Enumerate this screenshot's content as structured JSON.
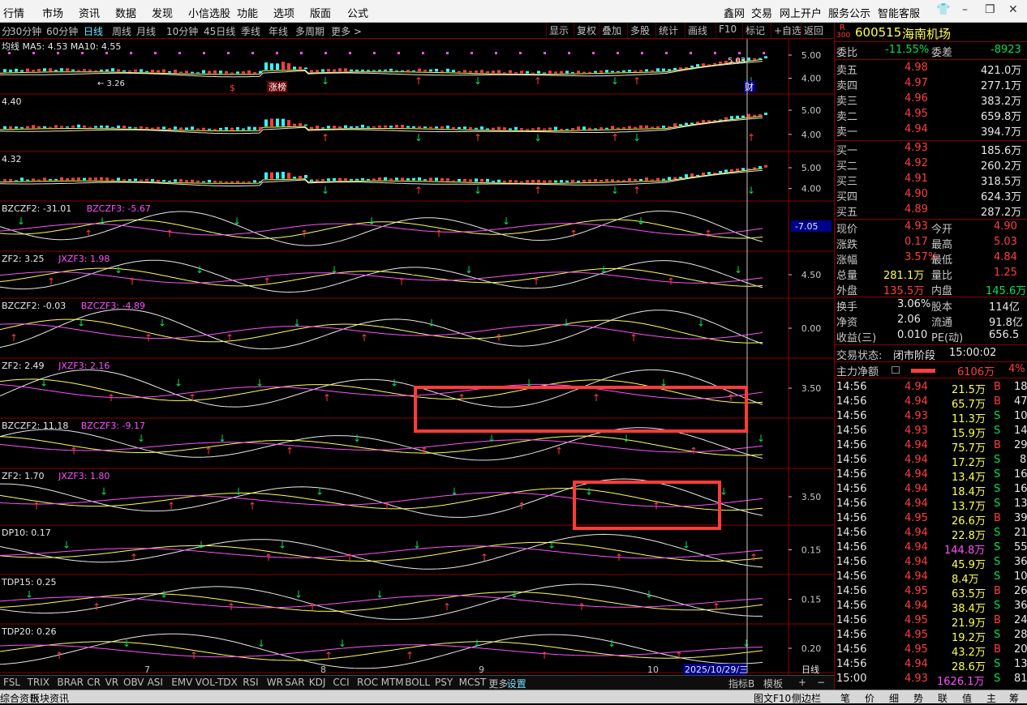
{
  "menu": {
    "items": [
      "行情",
      "市场",
      "资讯",
      "数据",
      "发现",
      "小信选股",
      "功能",
      "选项",
      "版面",
      "公式"
    ],
    "right_items": [
      "鑫网",
      "交易",
      "网上开户",
      "服务公示",
      "智能客服"
    ],
    "window_icons": [
      "shirt-icon",
      "minimize-icon",
      "restore-icon",
      "close-icon"
    ]
  },
  "periods": {
    "items": [
      "分",
      "30分钟",
      "60分钟",
      "日线",
      "周线",
      "月线",
      "10分钟",
      "45日线",
      "季线",
      "年线",
      "多周期",
      "更多 >"
    ],
    "active": "日线",
    "tools": [
      "显示",
      "复权",
      "叠加",
      "多股",
      "统计",
      "画线",
      "F10",
      "标记",
      "+自选",
      "返回"
    ]
  },
  "panes": [
    {
      "label_a": "均线  MA5: 4.53  MA10: 4.55",
      "label_b": "",
      "axis": [
        "5.00",
        "4.00"
      ],
      "notes": [
        "3.26",
        "5.03",
        "涨榜",
        "财",
        "$"
      ]
    },
    {
      "label_a": "4.40",
      "label_b": "",
      "axis": [
        "5.00",
        "4.00"
      ]
    },
    {
      "label_a": "4.32",
      "label_b": "",
      "axis": [
        "5.00",
        "4.00"
      ]
    },
    {
      "label_a": "BZCZF2: -31.01",
      "label_b": "BZCZF3: -5.67",
      "axis": [
        "-7.05"
      ]
    },
    {
      "label_a": "ZF2: 3.25",
      "label_b": "JXZF3: 1.98",
      "axis": [
        "4.50"
      ]
    },
    {
      "label_a": "BZCZF2: -0.03",
      "label_b": "BZCZF3: -4.89",
      "axis": [
        "0.00"
      ]
    },
    {
      "label_a": "ZF2: 2.49",
      "label_b": "JXZF3: 2.16",
      "axis": [
        "3.50"
      ]
    },
    {
      "label_a": "BZCZF2: 11.18",
      "label_b": "BZCZF3: -9.17",
      "axis": []
    },
    {
      "label_a": "ZF2: 1.70",
      "label_b": "JXZF3: 1.80",
      "axis": [
        "3.50"
      ]
    },
    {
      "label_a": "DP10: 0.17",
      "label_b": "",
      "axis": [
        "0.15"
      ]
    },
    {
      "label_a": "TDP15: 0.25",
      "label_b": "",
      "axis": [
        "0.15"
      ]
    },
    {
      "label_a": "TDP20: 0.26",
      "label_b": "",
      "axis": [
        "0.20"
      ]
    }
  ],
  "x_axis": {
    "months": [
      "7",
      "8",
      "9",
      "10"
    ],
    "date_label": "2025/10/29/三",
    "period_label": "日线"
  },
  "stock": {
    "code": "600515",
    "name": "海南机场",
    "prefix_top": "R",
    "prefix_bottom": "300"
  },
  "committee": {
    "ratio_label": "委比",
    "ratio": "-11.55%",
    "diff_label": "委差",
    "diff": "-8923"
  },
  "asks": [
    {
      "label": "卖五",
      "price": "4.98",
      "vol": "421.0万"
    },
    {
      "label": "卖四",
      "price": "4.97",
      "vol": "277.1万"
    },
    {
      "label": "卖三",
      "price": "4.96",
      "vol": "383.2万"
    },
    {
      "label": "卖二",
      "price": "4.95",
      "vol": "659.8万"
    },
    {
      "label": "卖一",
      "price": "4.94",
      "vol": "394.7万"
    }
  ],
  "bids": [
    {
      "label": "买一",
      "price": "4.93",
      "vol": "185.6万"
    },
    {
      "label": "买二",
      "price": "4.92",
      "vol": "260.2万"
    },
    {
      "label": "买三",
      "price": "4.91",
      "vol": "318.5万"
    },
    {
      "label": "买四",
      "price": "4.90",
      "vol": "624.3万"
    },
    {
      "label": "买五",
      "price": "4.89",
      "vol": "287.2万"
    }
  ],
  "quote": [
    {
      "l1": "现价",
      "v1": "4.93",
      "c1": "red",
      "l2": "今开",
      "v2": "4.90",
      "c2": "red"
    },
    {
      "l1": "涨跌",
      "v1": "0.17",
      "c1": "red",
      "l2": "最高",
      "v2": "5.03",
      "c2": "red"
    },
    {
      "l1": "涨幅",
      "v1": "3.57%",
      "c1": "red",
      "l2": "最低",
      "v2": "4.84",
      "c2": "red"
    },
    {
      "l1": "总量",
      "v1": "281.1万",
      "c1": "yel",
      "l2": "量比",
      "v2": "1.25",
      "c2": "red"
    },
    {
      "l1": "外盘",
      "v1": "135.5万",
      "c1": "red",
      "l2": "内盘",
      "v2": "145.6万",
      "c2": "grn"
    }
  ],
  "stats": [
    {
      "l1": "换手",
      "v1": "3.06%",
      "l2": "股本",
      "v2": "114亿"
    },
    {
      "l1": "净资",
      "v1": "2.06",
      "l2": "流通",
      "v2": "91.8亿"
    },
    {
      "l1": "收益(三)",
      "v1": "0.010",
      "l2": "PE(动)",
      "v2": "656.5"
    }
  ],
  "status": {
    "label": "交易状态:",
    "state": "闭市阶段",
    "time": "15:00:02"
  },
  "mainflow": {
    "label": "主力净额",
    "value": "6106万",
    "pct": "4%"
  },
  "ticks": [
    {
      "t": "14:56",
      "p": "4.94",
      "v": "21.5万",
      "s": "B",
      "n": "18"
    },
    {
      "t": "14:56",
      "p": "4.94",
      "v": "65.7万",
      "s": "B",
      "n": "47"
    },
    {
      "t": "14:56",
      "p": "4.93",
      "v": "11.3万",
      "s": "S",
      "n": "10"
    },
    {
      "t": "14:56",
      "p": "4.93",
      "v": "15.9万",
      "s": "S",
      "n": "14"
    },
    {
      "t": "14:56",
      "p": "4.94",
      "v": "75.7万",
      "s": "B",
      "n": "29"
    },
    {
      "t": "14:56",
      "p": "4.94",
      "v": "17.2万",
      "s": "S",
      "n": "8"
    },
    {
      "t": "14:56",
      "p": "4.94",
      "v": "13.4万",
      "s": "S",
      "n": "16"
    },
    {
      "t": "14:56",
      "p": "4.94",
      "v": "18.4万",
      "s": "S",
      "n": "16"
    },
    {
      "t": "14:56",
      "p": "4.94",
      "v": "13.7万",
      "s": "S",
      "n": "13"
    },
    {
      "t": "14:56",
      "p": "4.95",
      "v": "26.6万",
      "s": "B",
      "n": "39"
    },
    {
      "t": "14:56",
      "p": "4.94",
      "v": "22.8万",
      "s": "S",
      "n": "21"
    },
    {
      "t": "14:56",
      "p": "4.94",
      "v": "144.8万",
      "s": "S",
      "n": "55"
    },
    {
      "t": "14:56",
      "p": "4.94",
      "v": "45.9万",
      "s": "S",
      "n": "36"
    },
    {
      "t": "14:56",
      "p": "4.94",
      "v": "8.4万",
      "s": "S",
      "n": "10"
    },
    {
      "t": "14:56",
      "p": "4.95",
      "v": "63.5万",
      "s": "B",
      "n": "26"
    },
    {
      "t": "14:56",
      "p": "4.94",
      "v": "38.4万",
      "s": "S",
      "n": "36"
    },
    {
      "t": "14:56",
      "p": "4.95",
      "v": "21.9万",
      "s": "B",
      "n": "24"
    },
    {
      "t": "14:56",
      "p": "4.95",
      "v": "19.2万",
      "s": "S",
      "n": "28"
    },
    {
      "t": "14:56",
      "p": "4.95",
      "v": "43.2万",
      "s": "B",
      "n": "20"
    },
    {
      "t": "14:56",
      "p": "4.94",
      "v": "28.6万",
      "s": "S",
      "n": "13"
    },
    {
      "t": "15:00",
      "p": "4.93",
      "v": "1626.1万",
      "s": "S",
      "n": "81"
    }
  ],
  "indicator_tabs": [
    "FSL",
    "TRIX",
    "BRAR",
    "CR",
    "VR",
    "OBV",
    "ASI",
    "EMV",
    "VOL-TDX",
    "RSI",
    "WR",
    "SAR",
    "KDJ",
    "CCI",
    "ROC",
    "MTM",
    "BOLL",
    "PSY",
    "MCST",
    "更多",
    "设置"
  ],
  "indicator_tools": [
    "指标B",
    "模板",
    "+",
    "−"
  ],
  "bottom_tabs": [
    "综合资讯",
    "板块资讯"
  ],
  "bottom_right": [
    "图文F10",
    "侧边栏",
    "笔",
    "价",
    "细",
    "势",
    "联",
    "值",
    "主",
    "筹"
  ],
  "colors": {
    "up": "#ff3e3e",
    "down": "#00e05a",
    "volume": "#ffff54",
    "highlight": "#ff3b3b",
    "frame": "#8b0000"
  }
}
